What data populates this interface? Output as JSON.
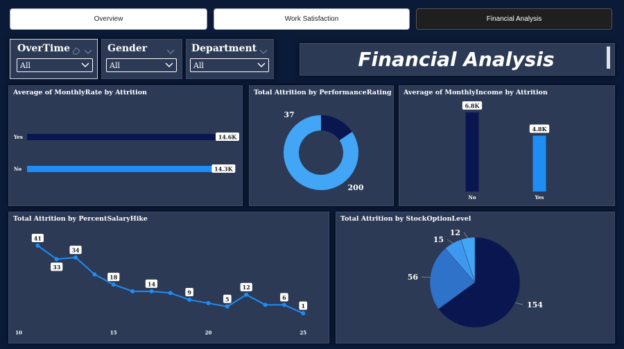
{
  "tabs": [
    {
      "label": "Overview",
      "active": false
    },
    {
      "label": "Work Satisfaction",
      "active": false
    },
    {
      "label": "Financial Analysis",
      "active": true
    }
  ],
  "slicers": [
    {
      "title": "OverTime",
      "value": "All"
    },
    {
      "title": "Gender",
      "value": "All"
    },
    {
      "title": "Department",
      "value": "All"
    }
  ],
  "page_title": "Financial Analysis",
  "colors": {
    "dark_navy": "#0a1650",
    "bright_blue": "#1e8ef5",
    "light_blue": "#42a5f5",
    "mid_blue": "#2f72c9",
    "panel": "#2c3a56",
    "background": "#0b1a36"
  },
  "chart_data": [
    {
      "type": "bar",
      "orientation": "horizontal",
      "title": "Average of MonthlyRate by Attrition",
      "categories": [
        "Yes",
        "No"
      ],
      "values": [
        14600,
        14300
      ],
      "data_labels": [
        "14.6K",
        "14.3K"
      ],
      "colors": [
        "#0a1650",
        "#1e8ef5"
      ],
      "xlim": [
        0,
        14600
      ]
    },
    {
      "type": "pie",
      "subtype": "donut",
      "title": "Total Attrition by PerformanceRating",
      "labels": [
        "37",
        "200"
      ],
      "values": [
        37,
        200
      ],
      "colors": [
        "#0a1650",
        "#42a5f5"
      ]
    },
    {
      "type": "bar",
      "orientation": "vertical",
      "title": "Average of MonthlyIncome by Attrition",
      "categories": [
        "No",
        "Yes"
      ],
      "values": [
        6800,
        4800
      ],
      "data_labels": [
        "6.8K",
        "4.8K"
      ],
      "colors": [
        "#0a1650",
        "#1e8ef5"
      ],
      "ylim": [
        0,
        6800
      ]
    },
    {
      "type": "line",
      "title": "Total Attrition by PercentSalaryHike",
      "x": [
        11,
        12,
        13,
        14,
        15,
        16,
        17,
        18,
        19,
        20,
        21,
        22,
        23,
        24,
        25
      ],
      "y": [
        41,
        33,
        34,
        24,
        18,
        14,
        14,
        13,
        9,
        7,
        5,
        12,
        6,
        6,
        1
      ],
      "labeled_points": [
        {
          "x": 11,
          "label": "41"
        },
        {
          "x": 12,
          "label": "33"
        },
        {
          "x": 13,
          "label": "34"
        },
        {
          "x": 15,
          "label": "18"
        },
        {
          "x": 17,
          "label": "14"
        },
        {
          "x": 19,
          "label": "9"
        },
        {
          "x": 21,
          "label": "5"
        },
        {
          "x": 22,
          "label": "12"
        },
        {
          "x": 24,
          "label": "6"
        },
        {
          "x": 25,
          "label": "1"
        }
      ],
      "xticks": [
        "10",
        "15",
        "20",
        "25"
      ],
      "xlim": [
        10,
        25
      ],
      "ylim": [
        0,
        41
      ],
      "color": "#1e8ef5"
    },
    {
      "type": "pie",
      "title": "Total Attrition by StockOptionLevel",
      "labels": [
        "154",
        "56",
        "15",
        "12"
      ],
      "values": [
        154,
        56,
        15,
        12
      ],
      "colors": [
        "#0a1650",
        "#2f72c9",
        "#3f98f0",
        "#42a5f5"
      ]
    }
  ]
}
